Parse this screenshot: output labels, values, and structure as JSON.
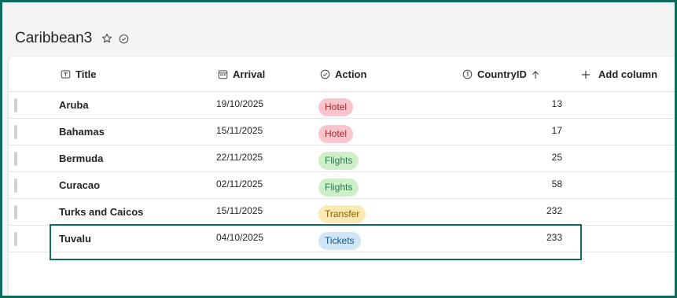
{
  "list": {
    "title": "Caribbean3"
  },
  "columns": {
    "title": "Title",
    "arrival": "Arrival",
    "action": "Action",
    "country_id": "CountryID",
    "add_column": "Add column"
  },
  "rows": [
    {
      "title": "Aruba",
      "arrival": "19/10/2025",
      "action": "Hotel",
      "country_id": "13"
    },
    {
      "title": "Bahamas",
      "arrival": "15/11/2025",
      "action": "Hotel",
      "country_id": "17"
    },
    {
      "title": "Bermuda",
      "arrival": "22/11/2025",
      "action": "Flights",
      "country_id": "25"
    },
    {
      "title": "Curacao",
      "arrival": "02/11/2025",
      "action": "Flights",
      "country_id": "58"
    },
    {
      "title": "Turks and Caicos",
      "arrival": "15/11/2025",
      "action": "Transfer",
      "country_id": "232"
    },
    {
      "title": "Tuvalu",
      "arrival": "04/10/2025",
      "action": "Tickets",
      "country_id": "233"
    }
  ],
  "action_colors": {
    "Hotel": {
      "bg": "#f9c4cc",
      "fg": "#a4262c"
    },
    "Flights": {
      "bg": "#cdf0c8",
      "fg": "#237b4b"
    },
    "Transfer": {
      "bg": "#fde9b2",
      "fg": "#8a5a00"
    },
    "Tickets": {
      "bg": "#cfe6f7",
      "fg": "#0f548c"
    }
  },
  "icons": {
    "title_col": "text-icon",
    "arrival_col": "calendar-icon",
    "action_col": "check-circle-icon",
    "country_col": "number-icon",
    "sort": "arrow-up-icon",
    "add": "plus-icon",
    "favorite": "star-icon",
    "status": "check-circle-icon"
  },
  "colors": {
    "accent": "#0e6b5c"
  }
}
